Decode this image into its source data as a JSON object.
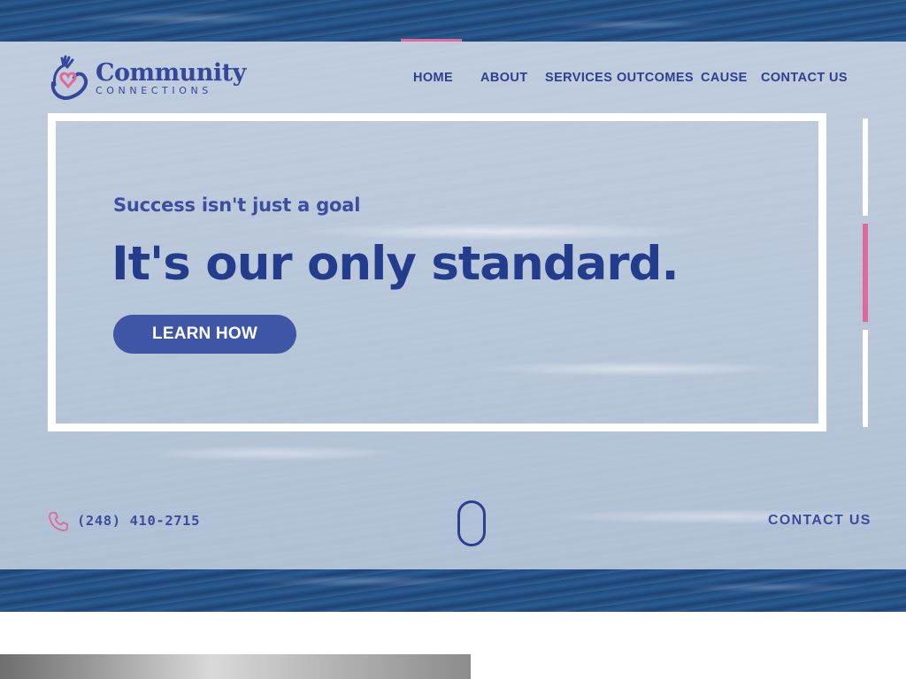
{
  "brand": {
    "name": "Community",
    "tagline": "CONNECTIONS",
    "primary_color": "#34479a",
    "accent_color": "#e0689a"
  },
  "nav": {
    "active": "HOME",
    "items": [
      {
        "label": "HOME"
      },
      {
        "label": "ABOUT"
      },
      {
        "label": "SERVICES"
      },
      {
        "label": "OUTCOMES"
      },
      {
        "label": "CAUSE"
      },
      {
        "label": "CONTACT US"
      }
    ]
  },
  "hero": {
    "kicker": "Success isn't just a goal",
    "headline": "It's our only standard.",
    "cta_label": "LEARN HOW",
    "slides_total": 3,
    "active_slide": 2
  },
  "footer_bar": {
    "phone_icon": "phone-icon",
    "phone": "(248) 410-2715",
    "contact_label": "CONTACT US",
    "scroll_icon": "mouse-scroll-icon"
  }
}
